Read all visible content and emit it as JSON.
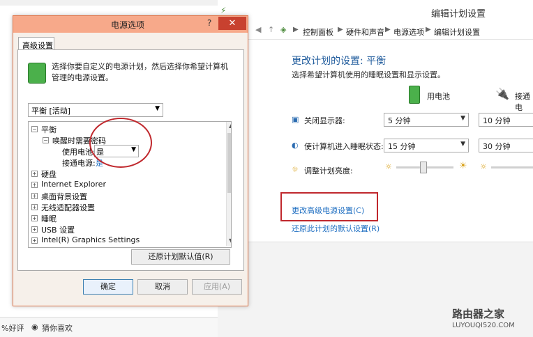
{
  "background": {
    "bottom_bar": {
      "item1": "%好评",
      "item2": "猜你喜欢"
    }
  },
  "control_panel": {
    "title": "编辑计划设置",
    "breadcrumb": [
      "控制面板",
      "硬件和声音",
      "电源选项",
      "编辑计划设置"
    ],
    "heading": "更改计划的设置: 平衡",
    "subheading": "选择希望计算机使用的睡眠设置和显示设置。",
    "on_battery": "用电池",
    "plugged_in": "接通电",
    "rows": [
      {
        "label": "关闭显示器:",
        "battery": "5 分钟",
        "plugged": "10 分钟"
      },
      {
        "label": "使计算机进入睡眠状态:",
        "battery": "15 分钟",
        "plugged": "30 分钟"
      },
      {
        "label": "调整计划亮度:"
      }
    ],
    "advanced_link": "更改高级电源设置(C)",
    "restore_link": "还原此计划的默认设置(R)"
  },
  "dialog": {
    "title": "电源选项",
    "help": "?",
    "close": "✕",
    "tab": "高级设置",
    "description": "选择你要自定义的电源计划，然后选择你希望计算机管理的电源设置。",
    "plan_selected": "平衡 [活动]",
    "tree": {
      "root": "平衡",
      "child": "唤醒时需要密码",
      "on_battery_label": "使用电池:",
      "on_battery_value": "是",
      "plugged_label": "接通电源:",
      "plugged_value": "是",
      "items": [
        "硬盘",
        "Internet Explorer",
        "桌面背景设置",
        "无线适配器设置",
        "睡眠",
        "USB 设置",
        "Intel(R) Graphics Settings"
      ]
    },
    "restore_button": "还原计划默认值(R)",
    "ok": "确定",
    "cancel": "取消",
    "apply": "应用(A)"
  },
  "watermark": {
    "title": "路由器之家",
    "url": "LUYOUQI520.COM"
  },
  "colors": {
    "accent_red": "#c0282d",
    "link_blue": "#1f6fc2",
    "dialog_title": "#f7a98a"
  }
}
